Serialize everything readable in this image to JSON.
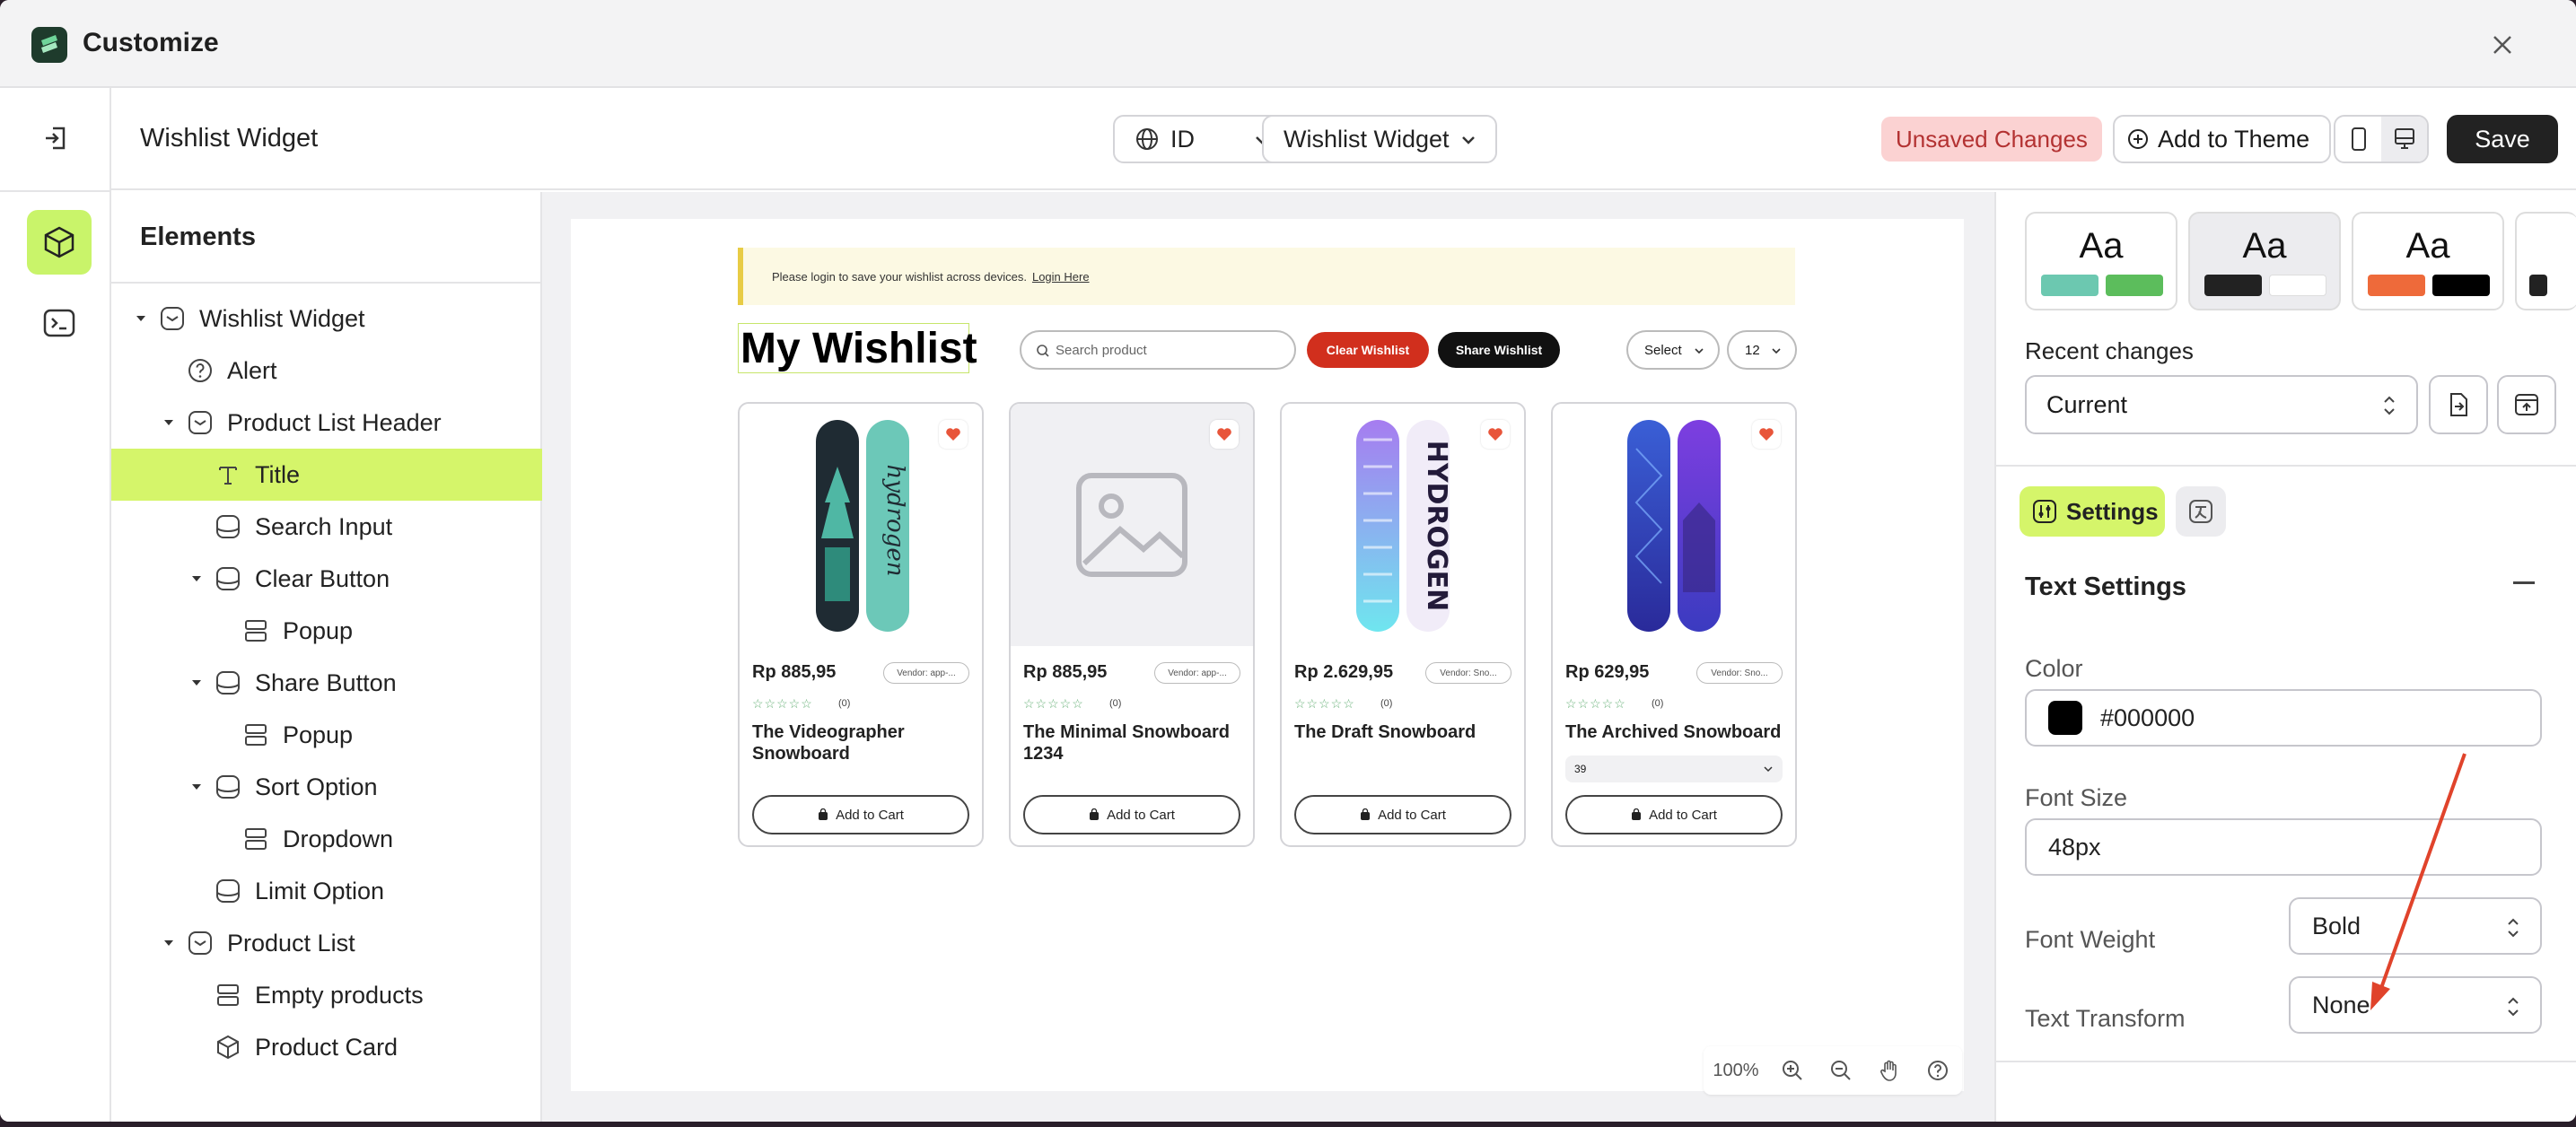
{
  "window": {
    "title": "Customize"
  },
  "topbar": {
    "page_name": "Wishlist Widget",
    "language": "ID",
    "widget_select": "Wishlist Widget",
    "unsaved": "Unsaved Changes",
    "add_to_theme": "Add to Theme",
    "save": "Save"
  },
  "elements_panel": {
    "title": "Elements",
    "tree": [
      {
        "label": "Wishlist Widget",
        "depth": 0,
        "caret": true,
        "icon": "section-icon"
      },
      {
        "label": "Alert",
        "depth": 1,
        "caret": false,
        "icon": "help-circle-icon"
      },
      {
        "label": "Product List Header",
        "depth": 1,
        "caret": true,
        "icon": "section-icon"
      },
      {
        "label": "Title",
        "depth": 2,
        "caret": false,
        "icon": "text-icon",
        "selected": true
      },
      {
        "label": "Search Input",
        "depth": 2,
        "caret": false,
        "icon": "block-icon"
      },
      {
        "label": "Clear Button",
        "depth": 2,
        "caret": true,
        "icon": "block-icon"
      },
      {
        "label": "Popup",
        "depth": 3,
        "caret": false,
        "icon": "layout-rows-icon"
      },
      {
        "label": "Share Button",
        "depth": 2,
        "caret": true,
        "icon": "block-icon"
      },
      {
        "label": "Popup",
        "depth": 3,
        "caret": false,
        "icon": "layout-rows-icon"
      },
      {
        "label": "Sort Option",
        "depth": 2,
        "caret": true,
        "icon": "block-icon"
      },
      {
        "label": "Dropdown",
        "depth": 3,
        "caret": false,
        "icon": "layout-rows-icon"
      },
      {
        "label": "Limit Option",
        "depth": 2,
        "caret": false,
        "icon": "block-icon"
      },
      {
        "label": "Product List",
        "depth": 1,
        "caret": true,
        "icon": "section-icon"
      },
      {
        "label": "Empty products",
        "depth": 2,
        "caret": false,
        "icon": "layout-rows-icon"
      },
      {
        "label": "Product Card",
        "depth": 2,
        "caret": false,
        "icon": "cube-outline-icon"
      }
    ]
  },
  "preview": {
    "alert_text": "Please login to save your wishlist across devices.",
    "alert_link": "Login Here",
    "title": "My Wishlist",
    "search_placeholder": "Search product",
    "clear_label": "Clear Wishlist",
    "share_label": "Share Wishlist",
    "sort_label": "Select",
    "limit_label": "12",
    "products": [
      {
        "price": "Rp 885,95",
        "vendor": "Vendor: app-...",
        "rating_count": "(0)",
        "name": "The Videographer Snowboard",
        "variant": null,
        "cta": "Add to Cart",
        "image": "board-teal"
      },
      {
        "price": "Rp 885,95",
        "vendor": "Vendor: app-...",
        "rating_count": "(0)",
        "name": "The Minimal Snowboard 1234",
        "variant": null,
        "cta": "Add to Cart",
        "image": "placeholder"
      },
      {
        "price": "Rp 2.629,95",
        "vendor": "Vendor: Sno...",
        "rating_count": "(0)",
        "name": "The Draft Snowboard",
        "variant": null,
        "cta": "Add to Cart",
        "image": "board-purple"
      },
      {
        "price": "Rp 629,95",
        "vendor": "Vendor: Sno...",
        "rating_count": "(0)",
        "name": "The Archived Snowboard",
        "variant": "39",
        "cta": "Add to Cart",
        "image": "board-blue"
      }
    ],
    "zoom": "100%"
  },
  "settings_panel": {
    "theme_presets": [
      {
        "label": "Aa",
        "colors": [
          "#6cc8b0",
          "#5cbd5c"
        ]
      },
      {
        "label": "Aa",
        "colors": [
          "#222222",
          "#ffffff"
        ],
        "active": true
      },
      {
        "label": "Aa",
        "colors": [
          "#ee6a3a",
          "#000000"
        ]
      }
    ],
    "recent_changes_label": "Recent changes",
    "recent_changes_value": "Current",
    "settings_tab": "Settings",
    "section_title": "Text Settings",
    "color_label": "Color",
    "color_value": "#000000",
    "font_size_label": "Font Size",
    "font_size_value": "48px",
    "font_weight_label": "Font Weight",
    "font_weight_value": "Bold",
    "text_transform_label": "Text Transform",
    "text_transform_value": "None"
  },
  "colors": {
    "accent": "#d5f56a",
    "danger": "#d12f1d",
    "arrow": "#e0432b"
  }
}
